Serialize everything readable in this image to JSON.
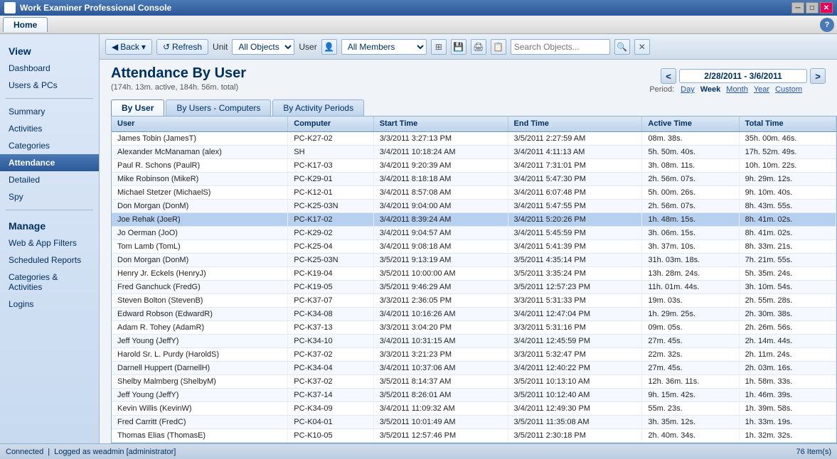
{
  "app": {
    "title": "Work Examiner Professional Console",
    "icon": "WE"
  },
  "titlebar": {
    "minimize": "─",
    "maximize": "□",
    "close": "✕"
  },
  "menubar": {
    "tabs": [
      {
        "label": "Home",
        "active": true
      }
    ],
    "help": "?"
  },
  "toolbar": {
    "back_label": "Back",
    "refresh_label": "Refresh",
    "unit_label": "Unit",
    "unit_value": "All Objects",
    "user_label": "User",
    "user_value": "All Members",
    "search_placeholder": "Search Objects...",
    "unit_options": [
      "All Objects"
    ],
    "user_options": [
      "All Members"
    ]
  },
  "sidebar": {
    "view_title": "View",
    "items": [
      {
        "label": "Dashboard",
        "active": false
      },
      {
        "label": "Users & PCs",
        "active": false
      },
      {
        "label": "Summary",
        "active": false
      },
      {
        "label": "Activities",
        "active": false
      },
      {
        "label": "Categories",
        "active": false
      },
      {
        "label": "Attendance",
        "active": true
      },
      {
        "label": "Detailed",
        "active": false
      },
      {
        "label": "Spy",
        "active": false
      }
    ],
    "manage_title": "Manage",
    "manage_items": [
      {
        "label": "Web & App Filters",
        "active": false
      },
      {
        "label": "Scheduled Reports",
        "active": false
      },
      {
        "label": "Categories & Activities",
        "active": false
      },
      {
        "label": "Logins",
        "active": false
      }
    ]
  },
  "page": {
    "title": "Attendance By User",
    "subtitle": "(174h. 13m. active, 184h. 56m. total)",
    "date_range": "2/28/2011 - 3/6/2011",
    "period_label": "Period:",
    "periods": [
      {
        "label": "Day",
        "active": false
      },
      {
        "label": "Week",
        "active": true
      },
      {
        "label": "Month",
        "active": false
      },
      {
        "label": "Year",
        "active": false
      },
      {
        "label": "Custom",
        "active": false
      }
    ]
  },
  "tabs": [
    {
      "label": "By User",
      "active": true
    },
    {
      "label": "By Users - Computers",
      "active": false
    },
    {
      "label": "By Activity Periods",
      "active": false
    }
  ],
  "table": {
    "columns": [
      "User",
      "Computer",
      "Start Time",
      "End Time",
      "Active Time",
      "Total Time"
    ],
    "rows": [
      [
        "James Tobin (JamesT)",
        "PC-K27-02",
        "3/3/2011 3:27:13 PM",
        "3/5/2011 2:27:59 AM",
        "08m. 38s.",
        "35h. 00m. 46s."
      ],
      [
        "Alexander McManaman (alex)",
        "SH",
        "3/4/2011 10:18:24 AM",
        "3/4/2011 4:11:13 AM",
        "5h. 50m. 40s.",
        "17h. 52m. 49s."
      ],
      [
        "Paul R. Schons (PaulR)",
        "PC-K17-03",
        "3/4/2011 9:20:39 AM",
        "3/4/2011 7:31:01 PM",
        "3h. 08m. 11s.",
        "10h. 10m. 22s."
      ],
      [
        "Mike Robinson (MikeR)",
        "PC-K29-01",
        "3/4/2011 8:18:18 AM",
        "3/4/2011 5:47:30 PM",
        "2h. 56m. 07s.",
        "9h. 29m. 12s."
      ],
      [
        "Michael Stetzer (MichaelS)",
        "PC-K12-01",
        "3/4/2011 8:57:08 AM",
        "3/4/2011 6:07:48 PM",
        "5h. 00m. 26s.",
        "9h. 10m. 40s."
      ],
      [
        "Don Morgan (DonM)",
        "PC-K25-03N",
        "3/4/2011 9:04:00 AM",
        "3/4/2011 5:47:55 PM",
        "2h. 56m. 07s.",
        "8h. 43m. 55s."
      ],
      [
        "Joe Rehak (JoeR)",
        "PC-K17-02",
        "3/4/2011 8:39:24 AM",
        "3/4/2011 5:20:26 PM",
        "1h. 48m. 15s.",
        "8h. 41m. 02s."
      ],
      [
        "Jo Oerman (JoO)",
        "PC-K29-02",
        "3/4/2011 9:04:57 AM",
        "3/4/2011 5:45:59 PM",
        "3h. 06m. 15s.",
        "8h. 41m. 02s."
      ],
      [
        "Tom Lamb (TomL)",
        "PC-K25-04",
        "3/4/2011 9:08:18 AM",
        "3/4/2011 5:41:39 PM",
        "3h. 37m. 10s.",
        "8h. 33m. 21s."
      ],
      [
        "Don Morgan (DonM)",
        "PC-K25-03N",
        "3/5/2011 9:13:19 AM",
        "3/5/2011 4:35:14 PM",
        "31h. 03m. 18s.",
        "7h. 21m. 55s."
      ],
      [
        "Henry Jr. Eckels (HenryJ)",
        "PC-K19-04",
        "3/5/2011 10:00:00 AM",
        "3/5/2011 3:35:24 PM",
        "13h. 28m. 24s.",
        "5h. 35m. 24s."
      ],
      [
        "Fred Ganchuck (FredG)",
        "PC-K19-05",
        "3/5/2011 9:46:29 AM",
        "3/5/2011 12:57:23 PM",
        "11h. 01m. 44s.",
        "3h. 10m. 54s."
      ],
      [
        "Steven Bolton (StevenB)",
        "PC-K37-07",
        "3/3/2011 2:36:05 PM",
        "3/3/2011 5:31:33 PM",
        "19m. 03s.",
        "2h. 55m. 28s."
      ],
      [
        "Edward Robson (EdwardR)",
        "PC-K34-08",
        "3/4/2011 10:16:26 AM",
        "3/4/2011 12:47:04 PM",
        "1h. 29m. 25s.",
        "2h. 30m. 38s."
      ],
      [
        "Adam R. Tohey (AdamR)",
        "PC-K37-13",
        "3/3/2011 3:04:20 PM",
        "3/3/2011 5:31:16 PM",
        "09m. 05s.",
        "2h. 26m. 56s."
      ],
      [
        "Jeff Young (JeffY)",
        "PC-K34-10",
        "3/4/2011 10:31:15 AM",
        "3/4/2011 12:45:59 PM",
        "27m. 45s.",
        "2h. 14m. 44s."
      ],
      [
        "Harold Sr. L. Purdy (HaroldS)",
        "PC-K37-02",
        "3/3/2011 3:21:23 PM",
        "3/3/2011 5:32:47 PM",
        "22m. 32s.",
        "2h. 11m. 24s."
      ],
      [
        "Darnell Huppert (DarnellH)",
        "PC-K34-04",
        "3/4/2011 10:37:06 AM",
        "3/4/2011 12:40:22 PM",
        "27m. 45s.",
        "2h. 03m. 16s."
      ],
      [
        "Shelby Malmberg (ShelbyM)",
        "PC-K37-02",
        "3/5/2011 8:14:37 AM",
        "3/5/2011 10:13:10 AM",
        "12h. 36m. 11s.",
        "1h. 58m. 33s."
      ],
      [
        "Jeff Young (JeffY)",
        "PC-K37-14",
        "3/5/2011 8:26:01 AM",
        "3/5/2011 10:12:40 AM",
        "9h. 15m. 42s.",
        "1h. 46m. 39s."
      ],
      [
        "Kevin Willis (KevinW)",
        "PC-K34-09",
        "3/4/2011 11:09:32 AM",
        "3/4/2011 12:49:30 PM",
        "55m. 23s.",
        "1h. 39m. 58s."
      ],
      [
        "Fred Carritt (FredC)",
        "PC-K04-01",
        "3/5/2011 10:01:49 AM",
        "3/5/2011 11:35:08 AM",
        "3h. 35m. 12s.",
        "1h. 33m. 19s."
      ],
      [
        "Thomas Elias (ThomasE)",
        "PC-K10-05",
        "3/5/2011 12:57:46 PM",
        "3/5/2011 2:30:18 PM",
        "2h. 40m. 34s.",
        "1h. 32m. 32s."
      ]
    ],
    "highlighted_row": 6
  },
  "statusbar": {
    "connected": "Connected",
    "logged_as": "Logged as weadmin [administrator]",
    "item_count": "76 Item(s)"
  }
}
